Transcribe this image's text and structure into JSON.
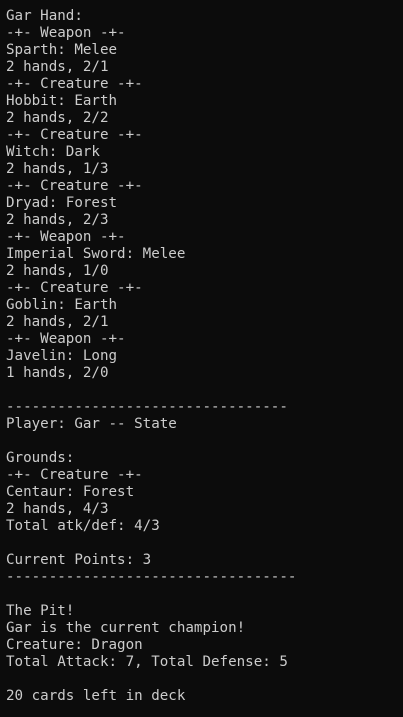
{
  "hand": {
    "title": "Gar Hand:",
    "cards": [
      {
        "header": "-+- Weapon -+-",
        "name_line": "Sparth: Melee",
        "stats_line": "2 hands, 2/1"
      },
      {
        "header": "-+- Creature -+-",
        "name_line": "Hobbit: Earth",
        "stats_line": "2 hands, 2/2"
      },
      {
        "header": "-+- Creature -+-",
        "name_line": "Witch: Dark",
        "stats_line": "2 hands, 1/3"
      },
      {
        "header": "-+- Creature -+-",
        "name_line": "Dryad: Forest",
        "stats_line": "2 hands, 2/3"
      },
      {
        "header": "-+- Weapon -+-",
        "name_line": "Imperial Sword: Melee",
        "stats_line": "2 hands, 1/0"
      },
      {
        "header": "-+- Creature -+-",
        "name_line": "Goblin: Earth",
        "stats_line": "2 hands, 2/1"
      },
      {
        "header": "-+- Weapon -+-",
        "name_line": "Javelin: Long",
        "stats_line": "1 hands, 2/0"
      }
    ]
  },
  "state": {
    "divider_top": "---------------------------------",
    "title": "Player: Gar -- State",
    "grounds_label": "Grounds:",
    "ground_card": {
      "header": "-+- Creature -+-",
      "name_line": "Centaur: Forest",
      "stats_line": "2 hands, 4/3"
    },
    "total_line": "Total atk/def: 4/3",
    "points_line": "Current Points: 3",
    "divider_bottom": "----------------------------------"
  },
  "pit": {
    "title": "The Pit!",
    "champion_line": "Gar is the current champion!",
    "creature_line": "Creature: Dragon",
    "totals_line": "Total Attack: 7, Total Defense: 5"
  },
  "deck": {
    "remaining_line": "20 cards left in deck"
  }
}
